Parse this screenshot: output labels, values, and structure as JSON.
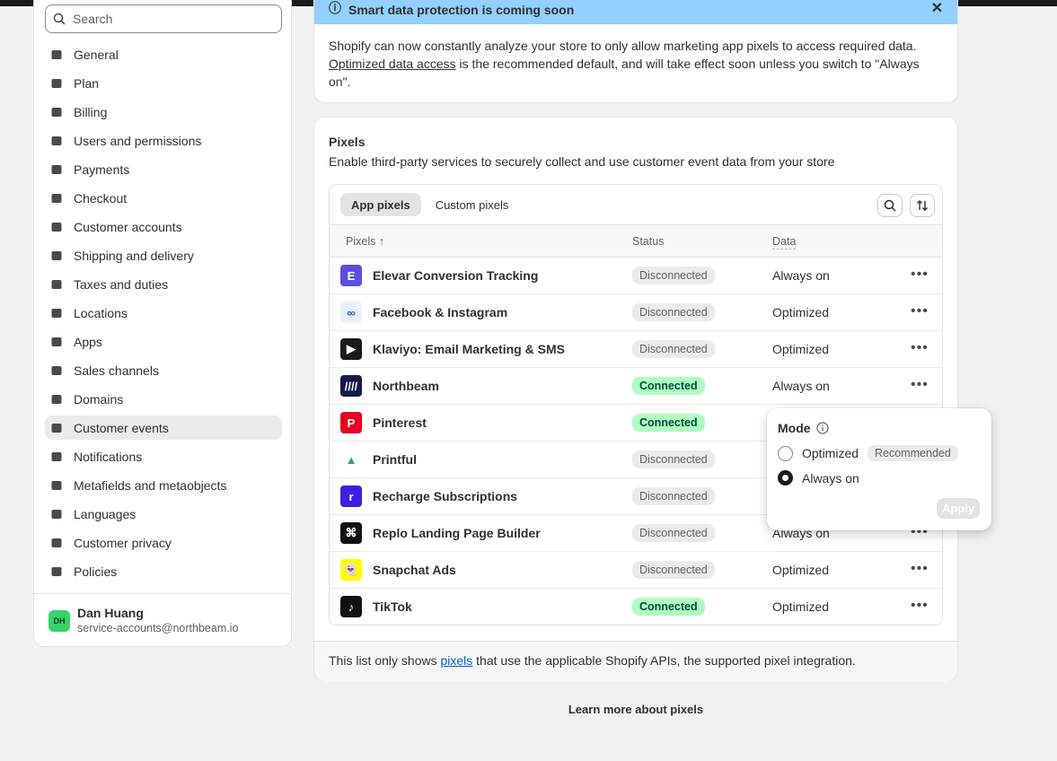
{
  "sidebar": {
    "search_placeholder": "Search",
    "items": [
      {
        "label": "General",
        "icon": "store-icon"
      },
      {
        "label": "Plan",
        "icon": "plan-icon"
      },
      {
        "label": "Billing",
        "icon": "billing-icon"
      },
      {
        "label": "Users and permissions",
        "icon": "users-icon"
      },
      {
        "label": "Payments",
        "icon": "payments-icon"
      },
      {
        "label": "Checkout",
        "icon": "cart-icon"
      },
      {
        "label": "Customer accounts",
        "icon": "person-icon"
      },
      {
        "label": "Shipping and delivery",
        "icon": "truck-icon"
      },
      {
        "label": "Taxes and duties",
        "icon": "tax-icon"
      },
      {
        "label": "Locations",
        "icon": "location-icon"
      },
      {
        "label": "Apps",
        "icon": "apps-icon"
      },
      {
        "label": "Sales channels",
        "icon": "channels-icon"
      },
      {
        "label": "Domains",
        "icon": "domains-icon"
      },
      {
        "label": "Customer events",
        "icon": "events-icon",
        "active": true
      },
      {
        "label": "Notifications",
        "icon": "bell-icon"
      },
      {
        "label": "Metafields and metaobjects",
        "icon": "metafields-icon"
      },
      {
        "label": "Languages",
        "icon": "languages-icon"
      },
      {
        "label": "Customer privacy",
        "icon": "lock-icon"
      },
      {
        "label": "Policies",
        "icon": "policies-icon"
      }
    ],
    "user": {
      "initials": "DH",
      "name": "Dan Huang",
      "email": "service-accounts@northbeam.io"
    }
  },
  "banner": {
    "title": "Smart data protection is coming soon",
    "body_before": "Shopify can now constantly analyze your store to only allow marketing app pixels to access required data.",
    "link": "Optimized data access",
    "body_after": " is the recommended default, and will take effect soon unless you switch to \"Always on\"."
  },
  "pixels": {
    "title": "Pixels",
    "subtitle": "Enable third-party services to securely collect and use customer event data from your store",
    "tabs": [
      "App pixels",
      "Custom pixels"
    ],
    "columns": {
      "name": "Pixels ↑",
      "status": "Status",
      "data": "Data"
    },
    "rows": [
      {
        "name": "Elevar Conversion Tracking",
        "status": "Disconnected",
        "connected": false,
        "data": "Always on",
        "logo": "E",
        "color": "#5b4ee0"
      },
      {
        "name": "Facebook & Instagram",
        "status": "Disconnected",
        "connected": false,
        "data": "Optimized",
        "logo": "∞",
        "color": "#e8f0ff"
      },
      {
        "name": "Klaviyo: Email Marketing & SMS",
        "status": "Disconnected",
        "connected": false,
        "data": "Optimized",
        "logo": "▶",
        "color": "#1a1a1a"
      },
      {
        "name": "Northbeam",
        "status": "Connected",
        "connected": true,
        "data": "Always on",
        "logo": "////",
        "color": "#141a4a"
      },
      {
        "name": "Pinterest",
        "status": "Connected",
        "connected": true,
        "data": "",
        "logo": "P",
        "color": "#e60023"
      },
      {
        "name": "Printful",
        "status": "Disconnected",
        "connected": false,
        "data": "",
        "logo": "▲",
        "color": "#ffffff"
      },
      {
        "name": "Recharge Subscriptions",
        "status": "Disconnected",
        "connected": false,
        "data": "",
        "logo": "r",
        "color": "#3d1ee0"
      },
      {
        "name": "Replo Landing Page Builder",
        "status": "Disconnected",
        "connected": false,
        "data": "Always on",
        "logo": "⌘",
        "color": "#111111"
      },
      {
        "name": "Snapchat Ads",
        "status": "Disconnected",
        "connected": false,
        "data": "Optimized",
        "logo": "👻",
        "color": "#fffc00"
      },
      {
        "name": "TikTok",
        "status": "Connected",
        "connected": true,
        "data": "Optimized",
        "logo": "♪",
        "color": "#111111"
      }
    ],
    "footer_before": "This list only shows ",
    "footer_link": "pixels",
    "footer_after": " that use the applicable Shopify APIs, the supported pixel integration."
  },
  "learn_more": "Learn more about pixels",
  "popover": {
    "title": "Mode",
    "options": [
      {
        "label": "Optimized",
        "badge": "Recommended",
        "checked": false
      },
      {
        "label": "Always on",
        "badge": "",
        "checked": true
      }
    ],
    "apply": "Apply"
  }
}
